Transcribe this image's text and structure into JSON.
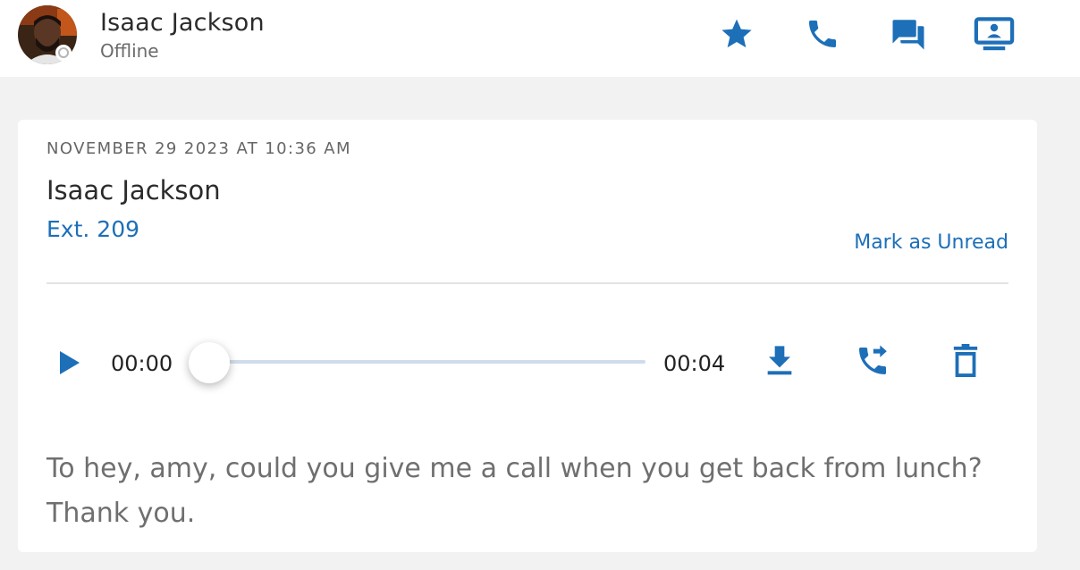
{
  "header": {
    "contact_name": "Isaac Jackson",
    "status": "Offline",
    "actions": [
      {
        "name": "favorite",
        "icon": "star-icon"
      },
      {
        "name": "call",
        "icon": "phone-icon"
      },
      {
        "name": "chat",
        "icon": "chat-icon"
      },
      {
        "name": "screen-share",
        "icon": "screen-share-icon"
      }
    ]
  },
  "voicemail": {
    "date": "NOVEMBER 29 2023 AT 10:36 AM",
    "caller_name": "Isaac Jackson",
    "extension": "Ext. 209",
    "mark_unread_label": "Mark as Unread",
    "player": {
      "current_time": "00:00",
      "total_time": "00:04",
      "progress": 0
    },
    "actions": [
      {
        "name": "download",
        "icon": "download-icon"
      },
      {
        "name": "forward-call",
        "icon": "call-forward-icon"
      },
      {
        "name": "delete",
        "icon": "trash-icon"
      }
    ],
    "transcript": "To hey, amy, could you give me a call when you get back from lunch? Thank you."
  },
  "colors": {
    "accent": "#1d6fb8",
    "background": "#f2f2f2",
    "card": "#ffffff",
    "text_primary": "#2b2b2b",
    "text_secondary": "#6f6f6f",
    "track": "#cfdcea"
  }
}
